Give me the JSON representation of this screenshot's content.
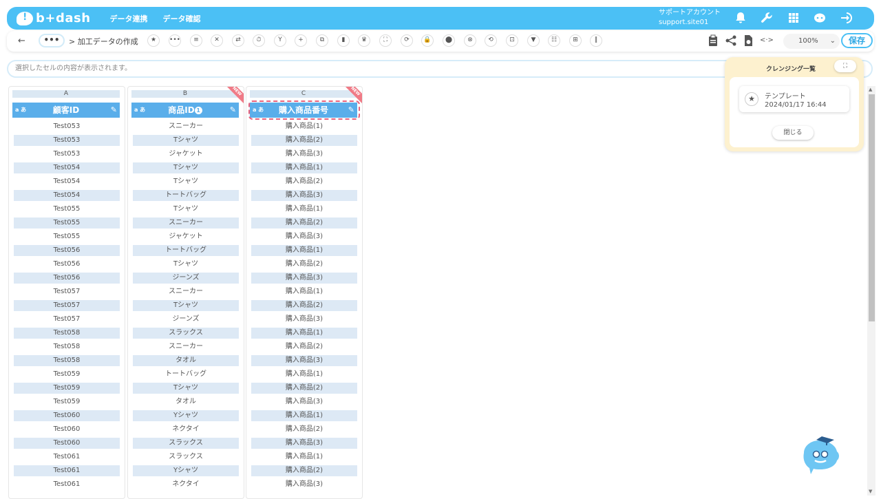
{
  "header": {
    "logo_text": "b+dash",
    "nav": [
      "データ連携",
      "データ確認"
    ],
    "account_name": "サポートアカウント",
    "account_site": "support.site01",
    "icons": [
      "bell-icon",
      "wrench-icon",
      "grid-icon",
      "chat-bot-icon",
      "logout-icon"
    ],
    "accent": "#4bc0f5"
  },
  "toolbar": {
    "back": "←",
    "more": "•••",
    "breadcrumb": "> 加工データの作成",
    "tool_icons": [
      "★",
      "•••",
      "≡",
      "✕",
      "⇄",
      "⏱",
      "Y",
      "+",
      "⧉",
      "▮",
      "♛",
      "⛶",
      "⟳",
      "🔒",
      "⬤",
      "⊗",
      "⟲",
      "⊡",
      "▼",
      "☷",
      "⊞",
      "‖"
    ],
    "zoom": "100%",
    "save_label": "保存"
  },
  "cellbar": {
    "placeholder": "選択したセルの内容が表示されます。"
  },
  "columns": [
    {
      "letter": "A",
      "title": "顧客ID",
      "type": "a あ",
      "is_new": false,
      "rows": [
        "Test053",
        "Test053",
        "Test053",
        "Test054",
        "Test054",
        "Test054",
        "Test055",
        "Test055",
        "Test055",
        "Test056",
        "Test056",
        "Test056",
        "Test057",
        "Test057",
        "Test057",
        "Test058",
        "Test058",
        "Test058",
        "Test059",
        "Test059",
        "Test059",
        "Test060",
        "Test060",
        "Test060",
        "Test061",
        "Test061",
        "Test061"
      ]
    },
    {
      "letter": "B",
      "title": "商品ID",
      "badge": "1",
      "type": "a あ",
      "is_new": true,
      "rows": [
        "スニーカー",
        "Tシャツ",
        "ジャケット",
        "Tシャツ",
        "Tシャツ",
        "トートバッグ",
        "Tシャツ",
        "スニーカー",
        "ジャケット",
        "トートバッグ",
        "Tシャツ",
        "ジーンズ",
        "スニーカー",
        "Tシャツ",
        "ジーンズ",
        "スラックス",
        "スニーカー",
        "タオル",
        "トートバッグ",
        "Tシャツ",
        "タオル",
        "Yシャツ",
        "ネクタイ",
        "スラックス",
        "スラックス",
        "Yシャツ",
        "ネクタイ"
      ]
    },
    {
      "letter": "C",
      "title": "購入商品番号",
      "type": "a あ",
      "is_new": true,
      "selected": true,
      "rows": [
        "購入商品(1)",
        "購入商品(2)",
        "購入商品(3)",
        "購入商品(1)",
        "購入商品(2)",
        "購入商品(3)",
        "購入商品(1)",
        "購入商品(2)",
        "購入商品(3)",
        "購入商品(1)",
        "購入商品(2)",
        "購入商品(3)",
        "購入商品(1)",
        "購入商品(2)",
        "購入商品(3)",
        "購入商品(1)",
        "購入商品(2)",
        "購入商品(3)",
        "購入商品(1)",
        "購入商品(2)",
        "購入商品(3)",
        "購入商品(1)",
        "購入商品(2)",
        "購入商品(3)",
        "購入商品(1)",
        "購入商品(2)",
        "購入商品(3)"
      ]
    }
  ],
  "new_label": "NEW",
  "cleansing_panel": {
    "title": "クレンジング一覧",
    "template_name": "テンプレート",
    "template_date": "2024/01/17 16:44",
    "close_label": "閉じる"
  }
}
